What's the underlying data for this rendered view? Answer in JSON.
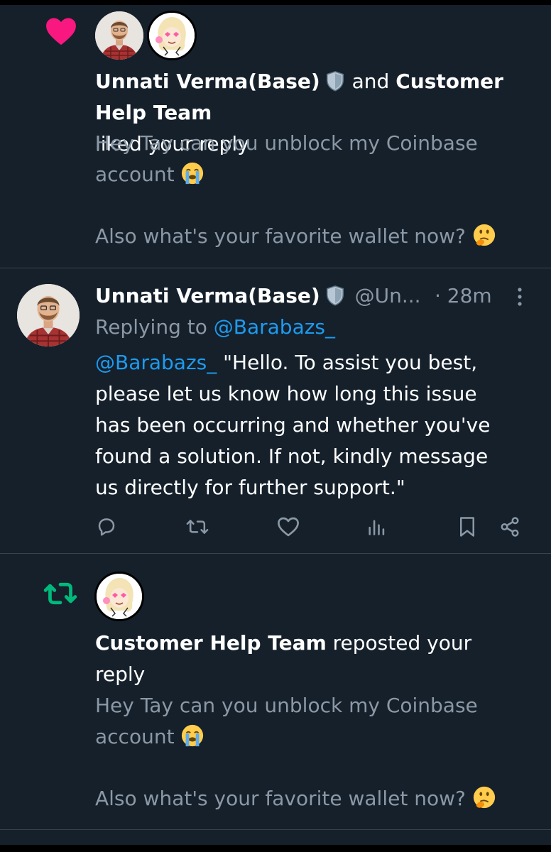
{
  "notifications": [
    {
      "type": "like",
      "icon": "heart-icon",
      "actor_1": "Unnati Verma(Base)",
      "conjunction": "and",
      "actor_2": "Customer Help Team",
      "action_text": "liked your reply",
      "reply_line_1": "Hey Tay can you unblock my Coinbase",
      "reply_line_2": "account",
      "reply_line_3": "Also what's your favorite wallet now?"
    },
    {
      "type": "repost",
      "icon": "repost-icon",
      "actor": "Customer Help Team",
      "action_line_1": "reposted your",
      "action_line_2": "reply",
      "reply_line_1": "Hey Tay can you unblock my Coinbase",
      "reply_line_2": "account",
      "reply_line_3": "Also what's your favorite wallet now?"
    }
  ],
  "tweet": {
    "display_name": "Unnati Verma(Base)",
    "handle": "@Un...",
    "time": "· 28m",
    "replying_to_label": "Replying to",
    "replying_to_handle": "@Barabazs_",
    "mention": "@Barabazs_",
    "body_line_1": "\"Hello. To assist you best,",
    "body_line_2": "please let us know how long this issue",
    "body_line_3": "has been occurring and whether you've",
    "body_line_4": "found a solution. If not, kindly message",
    "body_line_5": "us directly for further support.\""
  },
  "colors": {
    "background": "#15202b",
    "like": "#f91880",
    "repost": "#00ba7c",
    "link": "#1d9bf0",
    "secondary_text": "#8b98a5"
  }
}
